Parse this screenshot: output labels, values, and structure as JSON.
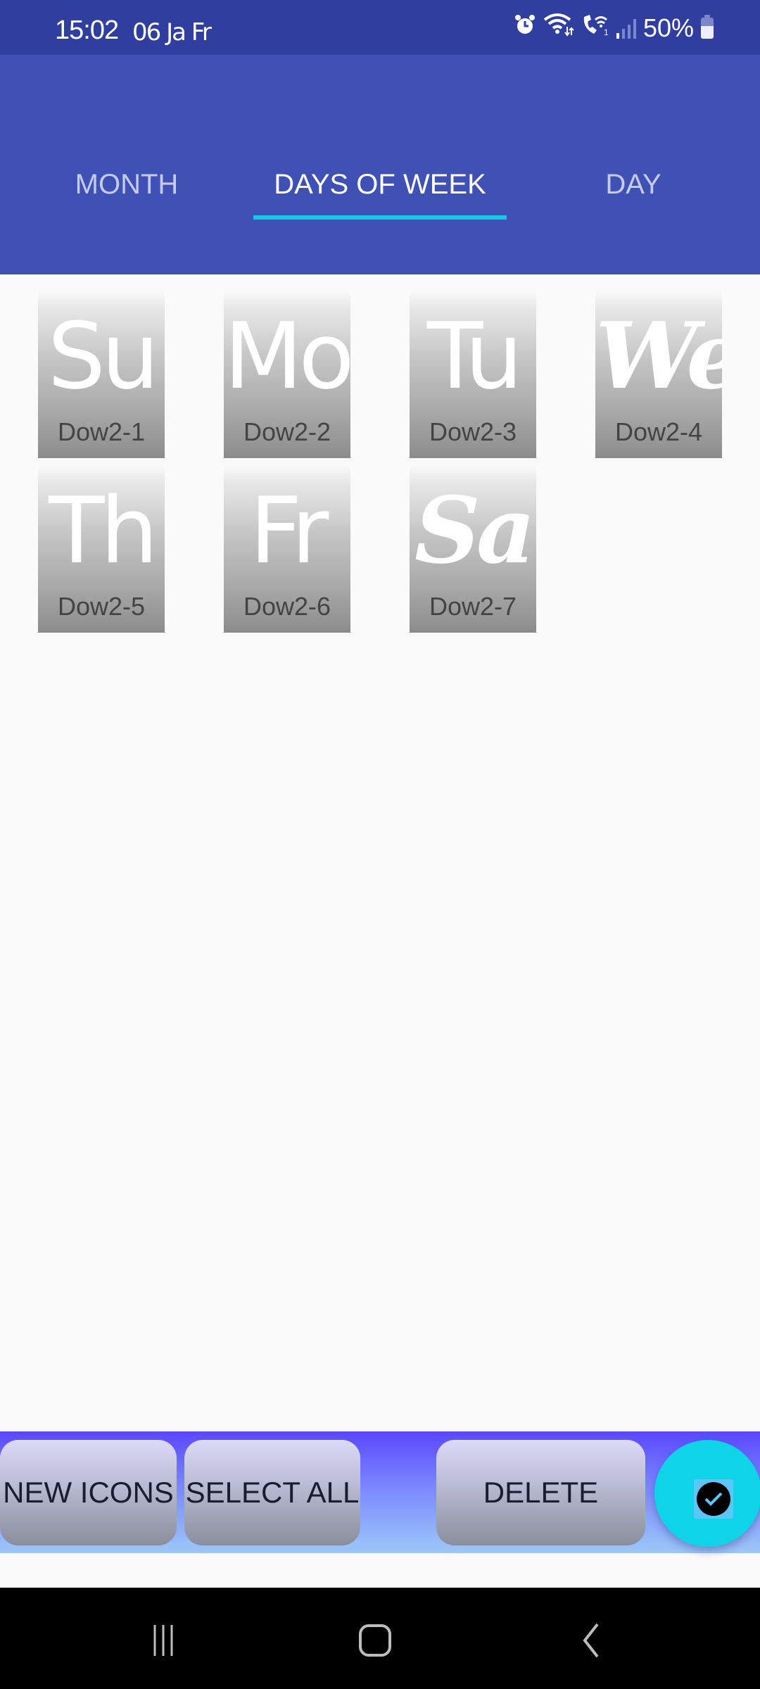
{
  "status_bar": {
    "time": "15:02",
    "date": "06 Ja Fr",
    "battery_percent": "50%",
    "icons": [
      "alarm-icon",
      "wifi-icon",
      "wifi-calling-icon",
      "signal-icon",
      "battery-icon"
    ]
  },
  "tabs": [
    {
      "label": "MONTH",
      "active": false
    },
    {
      "label": "DAYS OF WEEK",
      "active": true
    },
    {
      "label": "DAY",
      "active": false
    }
  ],
  "tiles": [
    {
      "glyph": "Su",
      "label": "Dow2-1"
    },
    {
      "glyph": "Mo",
      "label": "Dow2-2"
    },
    {
      "glyph": "Tu",
      "label": "Dow2-3"
    },
    {
      "glyph": "We",
      "label": "Dow2-4"
    },
    {
      "glyph": "Th",
      "label": "Dow2-5"
    },
    {
      "glyph": "Fr",
      "label": "Dow2-6"
    },
    {
      "glyph": "Sa",
      "label": "Dow2-7"
    }
  ],
  "actions": {
    "new_icons": "NEW ICONS",
    "select_all": "SELECT ALL",
    "delete": "DELETE",
    "fab_icon": "check-circle-icon"
  },
  "colors": {
    "status_bar": "#303f9f",
    "app_bar": "#3f51b5",
    "tab_indicator": "#18c8e4",
    "fab": "#0fd3e6"
  }
}
